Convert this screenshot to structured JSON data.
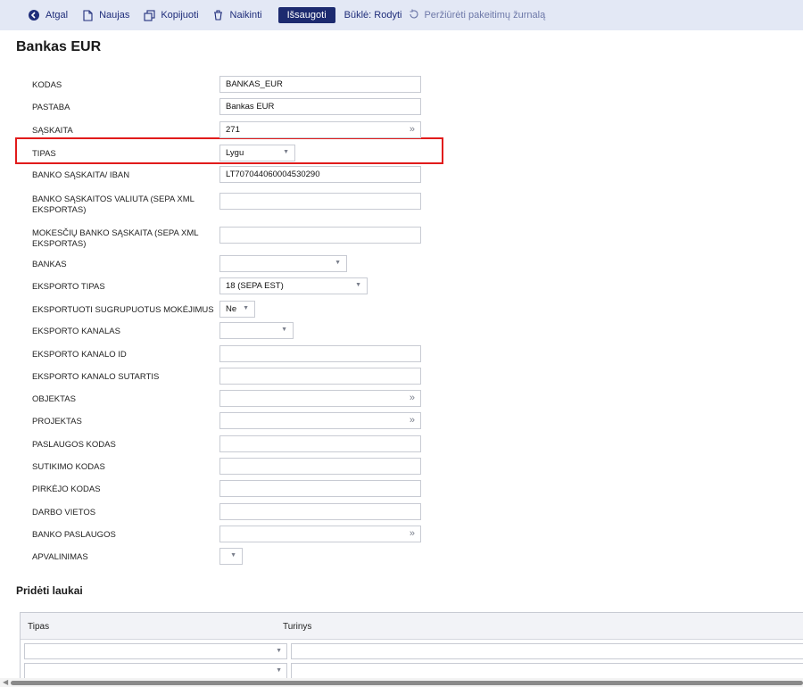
{
  "toolbar": {
    "back": {
      "label": "Atgal",
      "icon": "back-circle-icon"
    },
    "new": {
      "label": "Naujas",
      "icon": "document-icon"
    },
    "copy": {
      "label": "Kopijuoti",
      "icon": "copy-icon"
    },
    "delete": {
      "label": "Naikinti",
      "icon": "trash-icon"
    },
    "save_label": "Išsaugoti",
    "status": "Būklė: Rodyti",
    "log": {
      "label": "Peržiūrėti pakeitimų žurnalą",
      "icon": "history-icon"
    }
  },
  "page": {
    "title": "Bankas EUR"
  },
  "form": {
    "kodas": {
      "label": "KODAS",
      "value": "BANKAS_EUR"
    },
    "pastaba": {
      "label": "PASTABA",
      "value": "Bankas EUR"
    },
    "saskaita": {
      "label": "SĄSKAITA",
      "value": "271"
    },
    "tipas": {
      "label": "TIPAS",
      "value": "Lygu"
    },
    "iban": {
      "label": "BANKO SĄSKAITA/ IBAN",
      "value": "LT707044060004530290"
    },
    "valiuta": {
      "label": "BANKO SĄSKAITOS VALIUTA (SEPA XML EKSPORTAS)",
      "value": ""
    },
    "mokesciu": {
      "label": "MOKESČIŲ BANKO SĄSKAITA (SEPA XML EKSPORTAS)",
      "value": ""
    },
    "bankas": {
      "label": "BANKAS",
      "value": ""
    },
    "eksporto_tipas": {
      "label": "EKSPORTO TIPAS",
      "value": "18 (SEPA EST)"
    },
    "sugrupuotus": {
      "label": "EKSPORTUOTI SUGRUPUOTUS MOKĖJIMUS",
      "value": "Ne"
    },
    "kanalas": {
      "label": "EKSPORTO KANALAS",
      "value": ""
    },
    "kanalo_id": {
      "label": "EKSPORTO KANALO ID",
      "value": ""
    },
    "kanalo_sutartis": {
      "label": "EKSPORTO KANALO SUTARTIS",
      "value": ""
    },
    "objektas": {
      "label": "OBJEKTAS",
      "value": ""
    },
    "projektas": {
      "label": "PROJEKTAS",
      "value": ""
    },
    "paslaugos_kodas": {
      "label": "PASLAUGOS KODAS",
      "value": ""
    },
    "sutikimo_kodas": {
      "label": "SUTIKIMO KODAS",
      "value": ""
    },
    "pirkejo_kodas": {
      "label": "PIRKĖJO KODAS",
      "value": ""
    },
    "darbo_vietos": {
      "label": "DARBO VIETOS",
      "value": ""
    },
    "banko_paslaugos": {
      "label": "BANKO PASLAUGOS",
      "value": ""
    },
    "apvalinimas": {
      "label": "APVALINIMAS",
      "value": ""
    }
  },
  "extra_fields": {
    "title": "Pridėti laukai",
    "columns": [
      "Tipas",
      "Turinys"
    ]
  },
  "colors": {
    "toolbar_bg": "#e3e8f5",
    "accent": "#1c2a6f",
    "highlight": "#e11b1b"
  }
}
